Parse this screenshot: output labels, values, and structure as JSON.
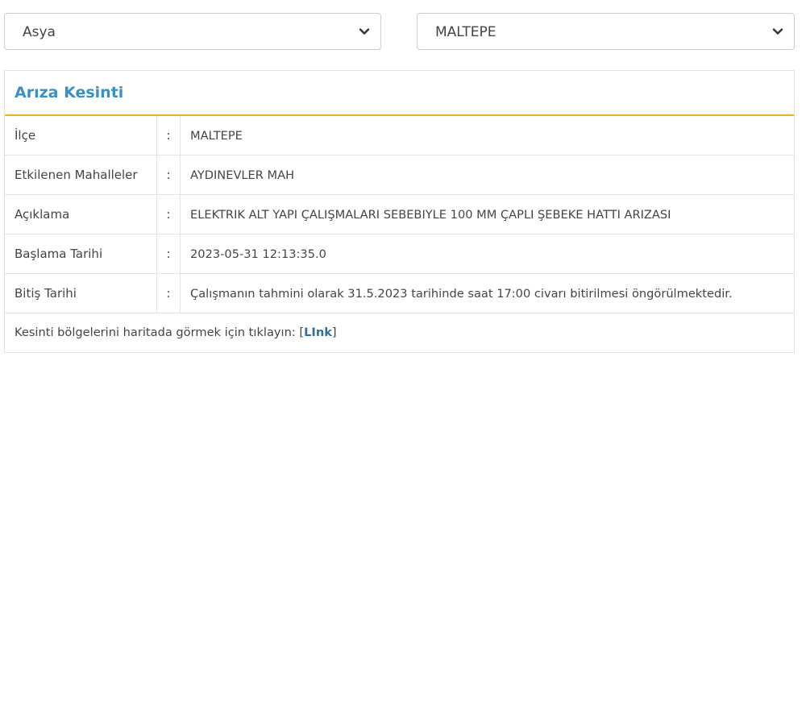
{
  "selectors": {
    "region": {
      "value": "Asya"
    },
    "district": {
      "value": "MALTEPE"
    }
  },
  "panel": {
    "title": "Arıza Kesinti",
    "separator": ":",
    "rows": [
      {
        "label": "İlçe",
        "value": "MALTEPE"
      },
      {
        "label": "Etkilenen Mahalleler",
        "value": "AYDINEVLER MAH"
      },
      {
        "label": "Açıklama",
        "value": "ELEKTRIK ALT YAPI ÇALIŞMALARI SEBEBIYLE 100 MM ÇAPLI ŞEBEKE HATTI ARIZASI"
      },
      {
        "label": "Başlama Tarihi",
        "value": "2023-05-31 12:13:35.0"
      },
      {
        "label": "Bitiş Tarihi",
        "value": "Çalışmanın tahmini olarak 31.5.2023 tarihinde saat 17:00 civarı bitirilmesi öngörülmektedir."
      }
    ],
    "footer": {
      "text": "Kesinti bölgelerini haritada görmek için tıklayın: ",
      "bracket_open": "[",
      "link_label": "LInk",
      "bracket_close": "]"
    }
  },
  "icons": {
    "dropdown": "chevron-down-icon"
  },
  "colors": {
    "title": "#3b8fc2",
    "accent_border": "#f0b323",
    "link": "#2e6f9e"
  }
}
